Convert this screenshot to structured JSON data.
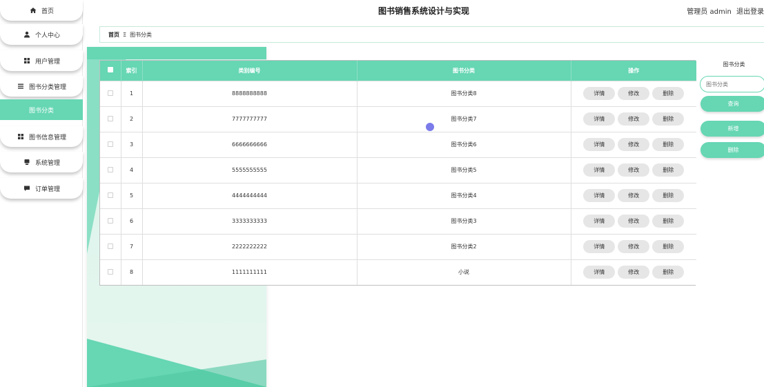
{
  "header": {
    "title": "图书销售系统设计与实现",
    "role": "管理员 admin",
    "logout": "退出登录"
  },
  "sidebar": {
    "items": [
      {
        "label": "首页",
        "icon": "home-icon"
      },
      {
        "label": "个人中心",
        "icon": "user-icon"
      },
      {
        "label": "用户管理",
        "icon": "grid-icon"
      },
      {
        "label": "图书分类管理",
        "icon": "list-icon"
      },
      {
        "label": "图书分类",
        "icon": ""
      },
      {
        "label": "图书信息管理",
        "icon": "grid-icon"
      },
      {
        "label": "系统管理",
        "icon": "monitor-icon"
      },
      {
        "label": "订单管理",
        "icon": "chat-icon"
      }
    ]
  },
  "breadcrumb": {
    "home": "首页",
    "separator": "Ξ",
    "current": "图书分类"
  },
  "table": {
    "headers": {
      "index": "索引",
      "code": "类别编号",
      "category": "图书分类",
      "ops": "操作"
    },
    "rows": [
      {
        "index": "1",
        "code": "8888888888",
        "category": "图书分类8"
      },
      {
        "index": "2",
        "code": "7777777777",
        "category": "图书分类7"
      },
      {
        "index": "3",
        "code": "6666666666",
        "category": "图书分类6"
      },
      {
        "index": "4",
        "code": "5555555555",
        "category": "图书分类5"
      },
      {
        "index": "5",
        "code": "4444444444",
        "category": "图书分类4"
      },
      {
        "index": "6",
        "code": "3333333333",
        "category": "图书分类3"
      },
      {
        "index": "7",
        "code": "2222222222",
        "category": "图书分类2"
      },
      {
        "index": "8",
        "code": "1111111111",
        "category": "小说"
      }
    ],
    "actions": {
      "detail": "详情",
      "edit": "修改",
      "delete": "删除"
    }
  },
  "search": {
    "label": "图书分类",
    "placeholder": "图书分类",
    "query_button": "查询",
    "add_button": "新增",
    "delete_button": "删除"
  },
  "colors": {
    "accent": "#66d6b3",
    "button_gray": "#e6e6e6"
  }
}
